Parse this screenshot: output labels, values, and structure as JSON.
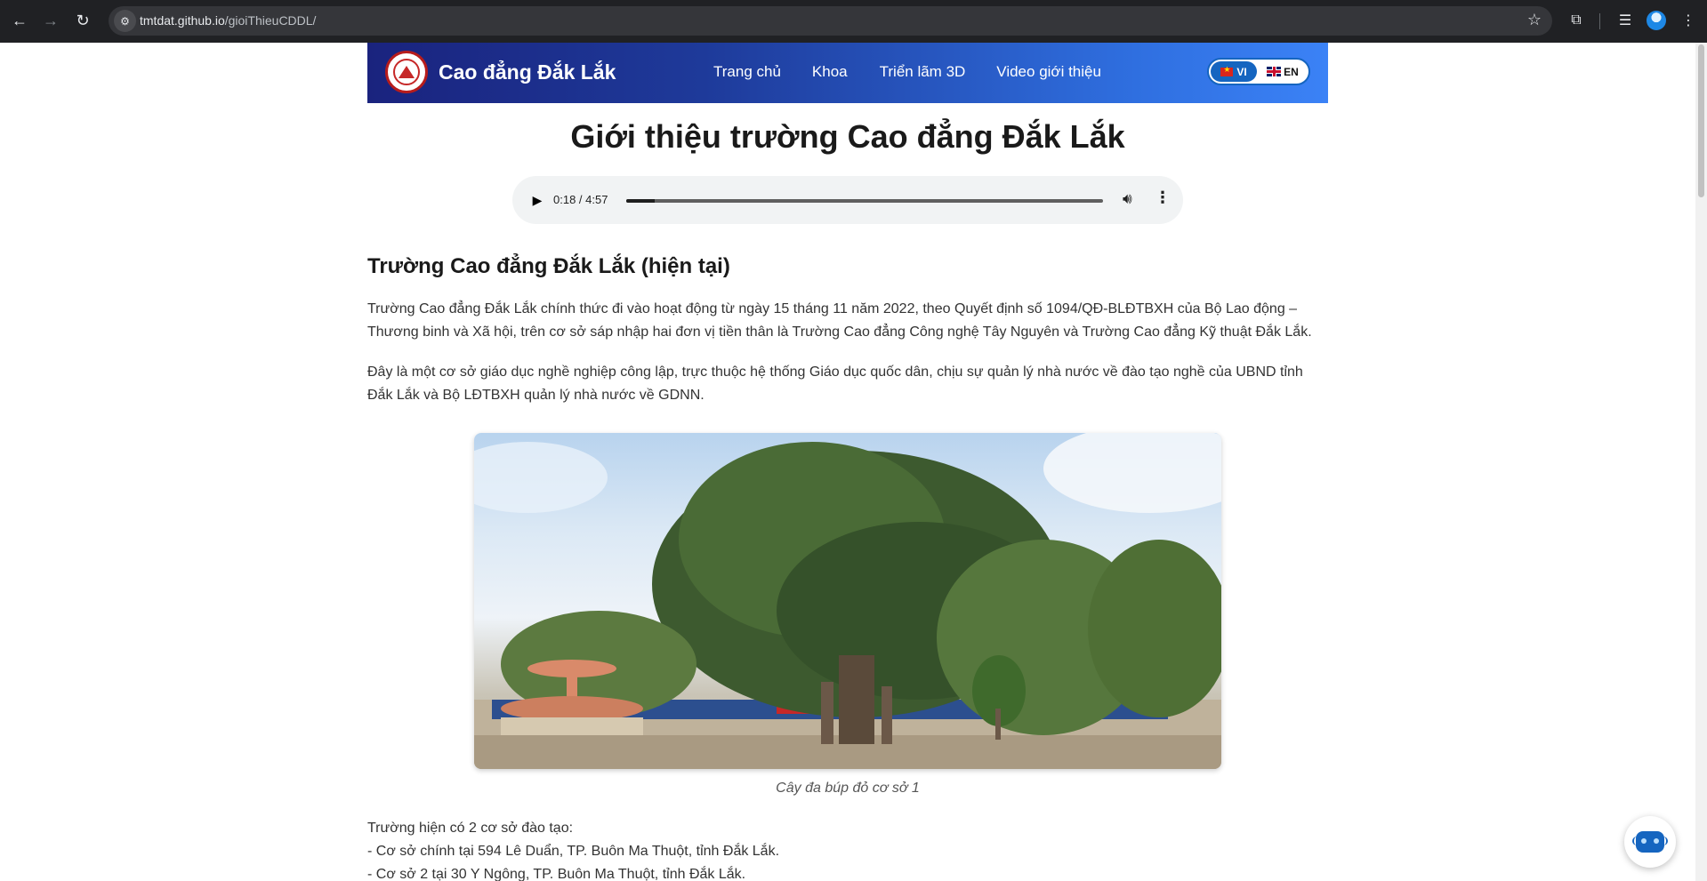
{
  "browser": {
    "url_host": "tmtdat.github.io",
    "url_path": "/gioiThieuCDDL/"
  },
  "header": {
    "brand": "Cao đẳng Đắk Lắk",
    "nav": [
      "Trang chủ",
      "Khoa",
      "Triển lãm 3D",
      "Video giới thiệu"
    ],
    "lang_vi": "VI",
    "lang_en": "EN",
    "active_lang": "VI"
  },
  "page": {
    "title": "Giới thiệu trường Cao đẳng Đắk Lắk"
  },
  "audio": {
    "time": "0:18 / 4:57",
    "progress": 0.0606
  },
  "section": {
    "heading": "Trường Cao đẳng Đắk Lắk (hiện tại)",
    "paragraph1": "Trường Cao đẳng Đắk Lắk chính thức đi vào hoạt động từ ngày 15 tháng 11 năm 2022, theo Quyết định số 1094/QĐ-BLĐTBXH của Bộ Lao động – Thương binh và Xã hội, trên cơ sở sáp nhập hai đơn vị tiền thân là Trường Cao đẳng Công nghệ Tây Nguyên và Trường Cao đẳng Kỹ thuật Đắk Lắk.",
    "paragraph2": "Đây là một cơ sở giáo dục nghề nghiệp công lập, trực thuộc hệ thống Giáo dục quốc dân, chịu sự quản lý nhà nước về đào tạo nghề của UBND tỉnh Đắk Lắk và Bộ LĐTBXH quản lý nhà nước về GDNN.",
    "image_caption": "Cây đa búp đỏ cơ sở 1",
    "campus_intro": "Trường hiện có 2 cơ sở đào tạo:",
    "campus_1": "- Cơ sở chính tại 594 Lê Duẩn, TP. Buôn Ma Thuột, tỉnh Đắk Lắk.",
    "campus_2": "- Cơ sở 2 tại 30 Y Ngông, TP. Buôn Ma Thuột, tỉnh Đắk Lắk."
  },
  "icons": {
    "back": "arrow-left-icon",
    "forward": "arrow-right-icon",
    "reload": "reload-icon",
    "site_info": "tune-icon",
    "bookmark": "star-icon",
    "extensions": "puzzle-icon",
    "reading_list": "reading-list-icon",
    "menu": "kebab-menu-icon",
    "play": "play-icon",
    "volume": "volume-icon",
    "audio_more": "kebab-menu-icon",
    "chatbot": "robot-icon"
  },
  "colors": {
    "header_start": "#1a237e",
    "header_end": "#3b82f6",
    "lang_active": "#1565c0"
  }
}
